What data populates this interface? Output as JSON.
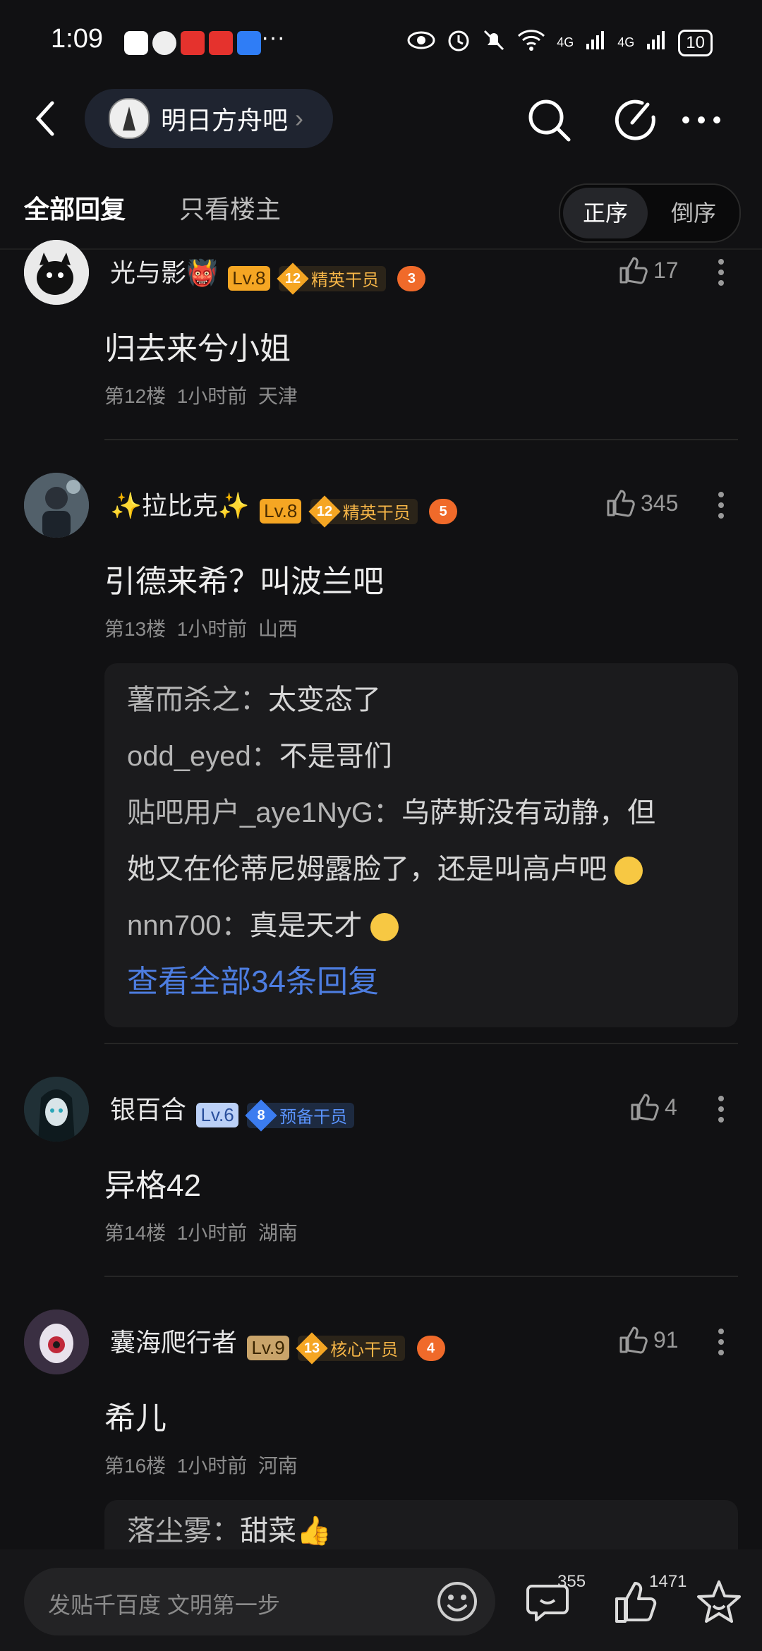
{
  "status_bar": {
    "time": "1:09",
    "more": "···",
    "net1": "4G",
    "net2": "4G",
    "battery": "10"
  },
  "header": {
    "forum_name": "明日方舟吧",
    "chevron": "›"
  },
  "tabs": {
    "all_replies": "全部回复",
    "op_only": "只看楼主",
    "sort_asc": "正序",
    "sort_desc": "倒序"
  },
  "posts": [
    {
      "username": "光与影👹",
      "level": "Lv.8",
      "badge_num": "12",
      "badge_label": "精英干员",
      "game_num": "3",
      "likes": "17",
      "content": "归去来兮小姐",
      "floor": "第12楼",
      "time": "1小时前",
      "location": "天津"
    },
    {
      "username": "✨拉比克✨",
      "level": "Lv.8",
      "badge_num": "12",
      "badge_label": "精英干员",
      "game_num": "5",
      "likes": "345",
      "content": "引德来希？叫波兰吧",
      "floor": "第13楼",
      "time": "1小时前",
      "location": "山西",
      "replies": [
        {
          "who": "薯而杀之：",
          "text": "太变态了"
        },
        {
          "who": "odd_eyed：",
          "text": "不是哥们"
        },
        {
          "who": "贴吧用户_aye1NyG：",
          "text": "乌萨斯没有动静，但"
        },
        {
          "who": "",
          "text": "她又在伦蒂尼姆露脸了，还是叫高卢吧"
        },
        {
          "who": "nnn700：",
          "text": "真是天才"
        }
      ],
      "view_all": "查看全部34条回复"
    },
    {
      "username": "银百合",
      "level": "Lv.6",
      "badge_num": "8",
      "badge_label": "预备干员",
      "likes": "4",
      "content": "异格42",
      "floor": "第14楼",
      "time": "1小时前",
      "location": "湖南"
    },
    {
      "username": "囊海爬行者",
      "level": "Lv.9",
      "badge_num": "13",
      "badge_label": "核心干员",
      "game_num": "4",
      "likes": "91",
      "content": "希儿",
      "floor": "第16楼",
      "time": "1小时前",
      "location": "河南",
      "replies": [
        {
          "who": "落尘雾：",
          "text": "甜菜👍"
        }
      ]
    }
  ],
  "bottom_bar": {
    "placeholder": "发贴千百度 文明第一步",
    "comments": "355",
    "likes": "1471"
  }
}
